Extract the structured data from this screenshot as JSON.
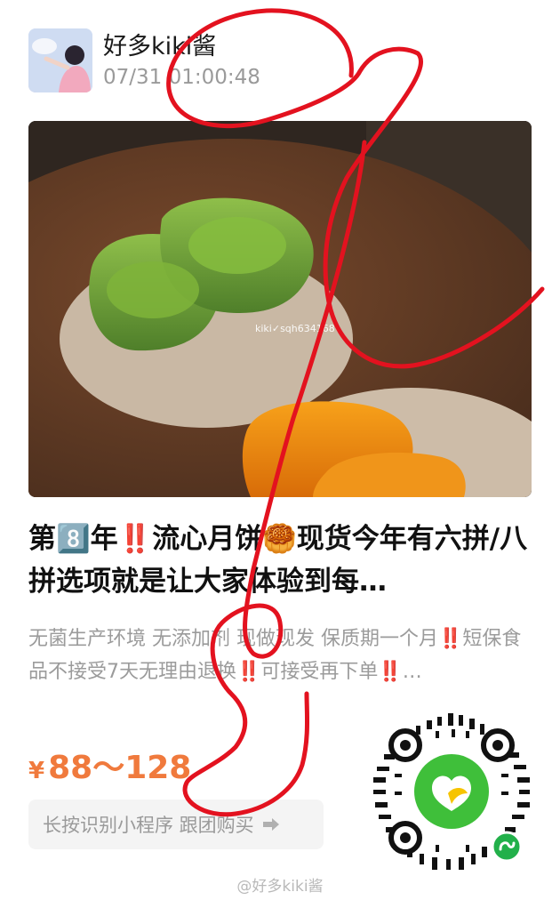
{
  "header": {
    "username": "好多kiki酱",
    "timestamp": "07/31 01:00:48"
  },
  "product": {
    "image_watermark": "kiki✓sqh634168",
    "title": "第8️⃣年‼️流心月饼🥮现货今年有六拼/八拼选项就是让大家体验到每…",
    "subtitle": "无菌生产环境 无添加剂 现做现发 保质期一个月‼️短保食品不接受7天无理由退换‼️可接受再下单‼️…",
    "price_symbol": "¥",
    "price_range": "88～128"
  },
  "actions": {
    "long_press_label": "长按识别小程序 跟团购买"
  },
  "footer": {
    "watermark": "@好多kiki酱"
  },
  "colors": {
    "price": "#f07a3d",
    "scribble": "#e3121f",
    "qr_logo_green": "#3fbf3a",
    "qr_badge_green": "#22b04a"
  }
}
